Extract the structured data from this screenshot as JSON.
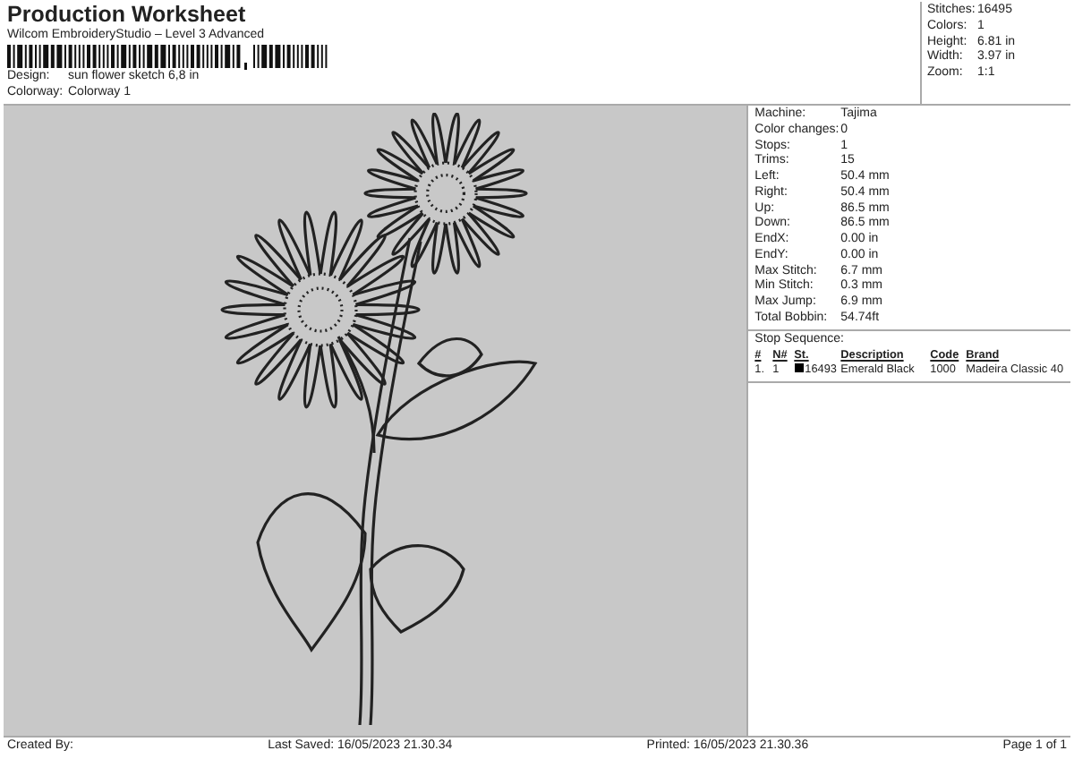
{
  "header": {
    "title": "Production Worksheet",
    "subtitle": "Wilcom EmbroideryStudio – Level 3 Advanced",
    "fields": [
      {
        "label": "Design:",
        "value": "sun flower sketch 6,8 in"
      },
      {
        "label": "Colorway:",
        "value": "Colorway 1"
      }
    ]
  },
  "summary": [
    {
      "label": "Stitches:",
      "value": "16495"
    },
    {
      "label": "Colors:",
      "value": "1"
    },
    {
      "label": "Height:",
      "value": "6.81 in"
    },
    {
      "label": "Width:",
      "value": "3.97 in"
    },
    {
      "label": "Zoom:",
      "value": "1:1"
    }
  ],
  "details": [
    {
      "label": "Machine:",
      "value": "Tajima"
    },
    {
      "label": "Color changes:",
      "value": "0"
    },
    {
      "label": "Stops:",
      "value": "1"
    },
    {
      "label": "Trims:",
      "value": "15"
    },
    {
      "label": "Left:",
      "value": "50.4 mm"
    },
    {
      "label": "Right:",
      "value": "50.4 mm"
    },
    {
      "label": "Up:",
      "value": "86.5 mm"
    },
    {
      "label": "Down:",
      "value": "86.5 mm"
    },
    {
      "label": "EndX:",
      "value": "0.00 in"
    },
    {
      "label": "EndY:",
      "value": "0.00 in"
    },
    {
      "label": "Max Stitch:",
      "value": "6.7 mm"
    },
    {
      "label": "Min Stitch:",
      "value": "0.3 mm"
    },
    {
      "label": "Max Jump:",
      "value": "6.9 mm"
    },
    {
      "label": "Total Bobbin:",
      "value": "54.74ft"
    }
  ],
  "stop_sequence": {
    "title": "Stop Sequence:",
    "columns": [
      "#",
      "N#",
      "St.",
      "Description",
      "Code",
      "Brand"
    ],
    "rows": [
      {
        "number": "1.",
        "n": "1",
        "color": "#000000",
        "stitches": "16493",
        "description": "Emerald Black",
        "code": "1000",
        "brand": "Madeira Classic 40"
      }
    ]
  },
  "footer": {
    "created": "Created By:",
    "saved": "Last Saved: 16/05/2023 21.30.34",
    "printed": "Printed: 16/05/2023 21.30.36",
    "page": "Page 1 of 1"
  }
}
